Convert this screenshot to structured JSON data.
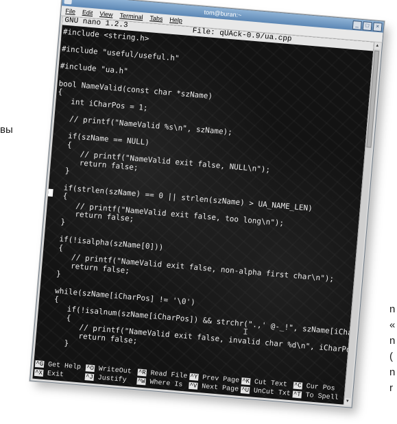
{
  "side_text": {
    "left": "вы",
    "right": [
      "n",
      "«",
      "n",
      "(",
      "n",
      "r"
    ]
  },
  "window": {
    "title": "tom@buran:~",
    "buttons": [
      "_",
      "□",
      "×"
    ]
  },
  "menu": [
    "File",
    "Edit",
    "View",
    "Terminal",
    "Tabs",
    "Help"
  ],
  "nano": {
    "version": "GNU nano 1.2.3",
    "file": "File: qUAck-0.9/ua.cpp"
  },
  "code_lines": [
    "#include <string.h>",
    "",
    "#include \"useful/useful.h\"",
    "",
    "#include \"ua.h\"",
    "",
    "bool NameValid(const char *szName)",
    "{",
    "   int iCharPos = 1;",
    "",
    "   // printf(\"NameValid %s\\n\", szName);",
    "",
    "   if(szName == NULL)",
    "   {",
    "      // printf(\"NameValid exit false, NULL\\n\");",
    "      return false;",
    "   }",
    "",
    "   if(strlen(szName) == 0 || strlen(szName) > UA_NAME_LEN)",
    "   {",
    "      // printf(\"NameValid exit false, too long\\n\");",
    "      return false;",
    "   }",
    "",
    "   if(!isalpha(szName[0]))",
    "   {",
    "      // printf(\"NameValid exit false, non-alpha first char\\n\");",
    "      return false;",
    "   }",
    "",
    "   while(szName[iCharPos] != '\\0')",
    "   {",
    "      if(!isalnum(szName[iCharPos]) && strchr(\".,' @-_!\", szName[iCharPos]) == $",
    "      {",
    "         // printf(\"NameValid exit false, invalid char %d\\n\", iCharPos);",
    "         return false;",
    "      }"
  ],
  "shortcuts": [
    {
      "key1": "^G",
      "label1": "Get Help",
      "key2": "^X",
      "label2": "Exit"
    },
    {
      "key1": "^O",
      "label1": "WriteOut",
      "key2": "^J",
      "label2": "Justify"
    },
    {
      "key1": "^R",
      "label1": "Read File",
      "key2": "^W",
      "label2": "Where Is"
    },
    {
      "key1": "^Y",
      "label1": "Prev Page",
      "key2": "^V",
      "label2": "Next Page"
    },
    {
      "key1": "^K",
      "label1": "Cut Text",
      "key2": "^U",
      "label2": "UnCut Txt"
    },
    {
      "key1": "^C",
      "label1": "Cur Pos",
      "key2": "^T",
      "label2": "To Spell"
    }
  ]
}
